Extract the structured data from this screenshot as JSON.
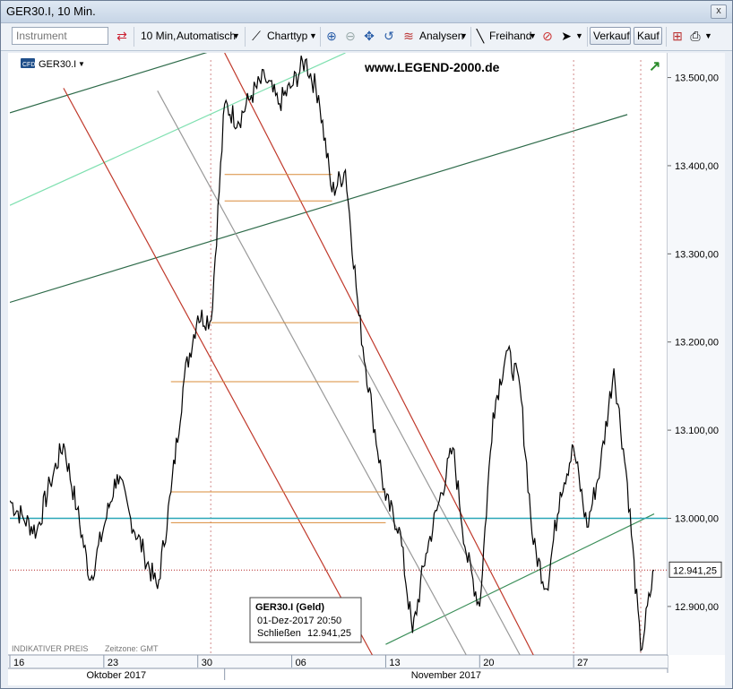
{
  "window": {
    "title": "GER30.I, 10 Min.",
    "close_symbol": "x"
  },
  "toolbar": {
    "instrument_placeholder": "Instrument",
    "period": "10 Min,",
    "mode": "Automatisch",
    "charttype": "Charttyp",
    "analysen": "Analysen",
    "freihand": "Freihand",
    "verkauf": "Verkauf",
    "kauf": "Kauf"
  },
  "chart_header": {
    "symbol": "GER30.I",
    "cfd_badge": "CFD",
    "watermark": "www.LEGEND-2000.de"
  },
  "footer": {
    "indicative": "INDIKATIVER PREIS",
    "timezone": "Zeitzone: GMT"
  },
  "tooltip": {
    "title": "GER30.I (Geld)",
    "datetime": "01-Dez-2017 20:50",
    "close_label": "Schließen",
    "close_value": "12.941,25"
  },
  "colors": {
    "price": "#000000",
    "red_channel": "#c0392b",
    "gray_channel": "#999999",
    "dark_green": "#2e6b4a",
    "light_green": "#7fe0b0",
    "orange_levels": "#d98c3a",
    "cyan_level": "#2aa7b8",
    "price_marker": "#b22222"
  },
  "chart_data": {
    "type": "line",
    "instrument": "GER30.I",
    "timeframe": "10 Min.",
    "y_axis": {
      "ticks": [
        12900,
        13000,
        13100,
        13200,
        13300,
        13400,
        13500
      ],
      "tick_labels": [
        "12.900,00",
        "13.000,00",
        "13.100,00",
        "13.200,00",
        "13.300,00",
        "13.400,00",
        "13.500,00"
      ],
      "range": [
        12845,
        13528
      ],
      "side": "right"
    },
    "x_axis": {
      "day_ticks": [
        "16",
        "23",
        "30",
        "06",
        "13",
        "20",
        "27"
      ],
      "months": [
        "Oktober 2017",
        "November 2017"
      ],
      "range": [
        "2017-10-16",
        "2017-12-04"
      ]
    },
    "last_price": {
      "value": 12941.25,
      "label": "12.941,25"
    },
    "horizontal_levels": [
      13000,
      13390,
      13360,
      13222,
      13155,
      13030,
      12995
    ],
    "price_path": [
      [
        "2017-10-16",
        13020
      ],
      [
        "2017-10-17",
        13000
      ],
      [
        "2017-10-18",
        12985
      ],
      [
        "2017-10-19",
        13040
      ],
      [
        "2017-10-20",
        13085
      ],
      [
        "2017-10-21",
        13010
      ],
      [
        "2017-10-22",
        12930
      ],
      [
        "2017-10-23",
        12990
      ],
      [
        "2017-10-24",
        13050
      ],
      [
        "2017-10-25",
        13000
      ],
      [
        "2017-10-26",
        12960
      ],
      [
        "2017-10-27",
        12920
      ],
      [
        "2017-10-28",
        13030
      ],
      [
        "2017-10-29",
        13160
      ],
      [
        "2017-10-30",
        13230
      ],
      [
        "2017-10-31",
        13225
      ],
      [
        "2017-11-01",
        13470
      ],
      [
        "2017-11-02",
        13450
      ],
      [
        "2017-11-03",
        13480
      ],
      [
        "2017-11-04",
        13500
      ],
      [
        "2017-11-05",
        13470
      ],
      [
        "2017-11-06",
        13490
      ],
      [
        "2017-11-07",
        13520
      ],
      [
        "2017-11-08",
        13480
      ],
      [
        "2017-11-09",
        13370
      ],
      [
        "2017-11-10",
        13395
      ],
      [
        "2017-11-11",
        13230
      ],
      [
        "2017-11-12",
        13120
      ],
      [
        "2017-11-13",
        13020
      ],
      [
        "2017-11-14",
        12990
      ],
      [
        "2017-11-15",
        12870
      ],
      [
        "2017-11-16",
        12960
      ],
      [
        "2017-11-17",
        13020
      ],
      [
        "2017-11-18",
        13080
      ],
      [
        "2017-11-19",
        12960
      ],
      [
        "2017-11-20",
        12900
      ],
      [
        "2017-11-21",
        13120
      ],
      [
        "2017-11-22",
        13190
      ],
      [
        "2017-11-23",
        13150
      ],
      [
        "2017-11-24",
        12970
      ],
      [
        "2017-11-25",
        12920
      ],
      [
        "2017-11-26",
        13030
      ],
      [
        "2017-11-27",
        13080
      ],
      [
        "2017-11-28",
        12990
      ],
      [
        "2017-11-29",
        13060
      ],
      [
        "2017-11-30",
        13170
      ],
      [
        "2017-12-01",
        13040
      ],
      [
        "2017-12-02",
        12850
      ],
      [
        "2017-12-03",
        12941.25
      ]
    ],
    "trend_lines": [
      {
        "name": "dark-green-upper",
        "color": "#2e6b4a",
        "from": [
          "2017-10-16",
          13460
        ],
        "to": [
          "2017-10-31",
          13530
        ]
      },
      {
        "name": "dark-green-mid",
        "color": "#2e6b4a",
        "from": [
          "2017-10-16",
          13245
        ],
        "to": [
          "2017-12-01",
          13458
        ]
      },
      {
        "name": "light-green",
        "color": "#7fe0b0",
        "from": [
          "2017-10-16",
          13355
        ],
        "to": [
          "2017-11-10",
          13528
        ]
      },
      {
        "name": "green-support",
        "color": "#3c8f5a",
        "from": [
          "2017-11-13",
          12857
        ],
        "to": [
          "2017-12-03",
          13005
        ]
      },
      {
        "name": "red-1",
        "color": "#c0392b",
        "from": [
          "2017-10-20",
          13488
        ],
        "to": [
          "2017-11-12",
          12845
        ]
      },
      {
        "name": "red-2",
        "color": "#c0392b",
        "from": [
          "2017-11-01",
          13528
        ],
        "to": [
          "2017-11-24",
          12845
        ]
      },
      {
        "name": "gray-1",
        "color": "#999999",
        "from": [
          "2017-10-27",
          13485
        ],
        "to": [
          "2017-11-19",
          12845
        ]
      },
      {
        "name": "gray-2",
        "color": "#999999",
        "from": [
          "2017-11-11",
          13185
        ],
        "to": [
          "2017-11-23",
          12845
        ]
      }
    ]
  }
}
